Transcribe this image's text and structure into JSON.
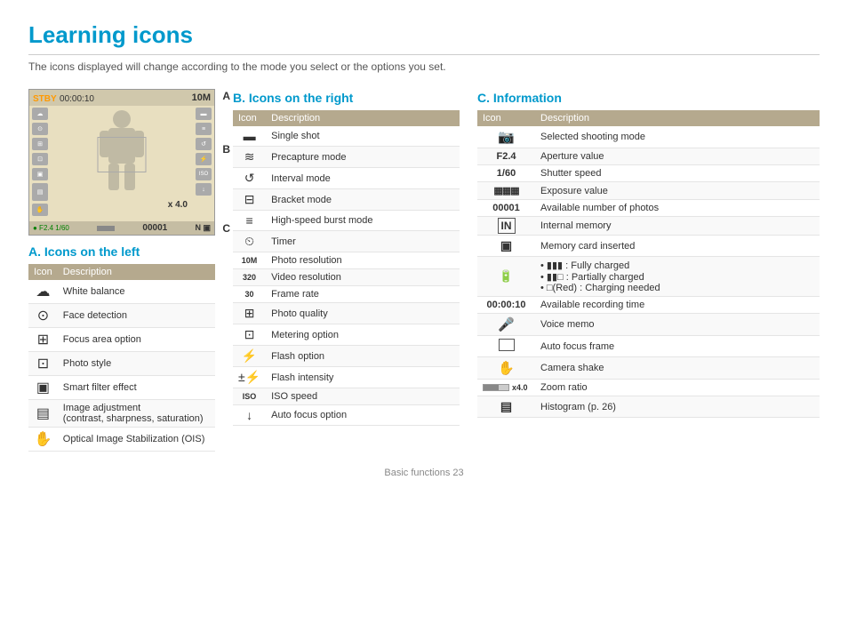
{
  "page": {
    "title": "Learning icons",
    "subtitle": "The icons displayed will change according to the mode you select or the options you set.",
    "footer": "Basic functions   23"
  },
  "viewfinder": {
    "stby": "STBY",
    "timer": "00:00:10",
    "top_right_icon": "10M",
    "zoom": "x 4.0",
    "frame_number": "00001",
    "label_a": "A",
    "label_b": "B",
    "label_c": "C"
  },
  "section_a": {
    "title": "A. Icons on the left",
    "col_icon": "Icon",
    "col_desc": "Description",
    "rows": [
      {
        "icon": "cloud",
        "desc": "White balance"
      },
      {
        "icon": "face",
        "desc": "Face detection"
      },
      {
        "icon": "focus",
        "desc": "Focus area option"
      },
      {
        "icon": "style",
        "desc": "Photo style"
      },
      {
        "icon": "filter",
        "desc": "Smart filter effect"
      },
      {
        "icon": "image-adj",
        "desc": "Image adjustment\n(contrast, sharpness, saturation)"
      },
      {
        "icon": "ois",
        "desc": "Optical Image Stabilization (OIS)"
      }
    ]
  },
  "section_b": {
    "title": "B. Icons on the right",
    "col_icon": "Icon",
    "col_desc": "Description",
    "rows": [
      {
        "icon": "single-shot",
        "desc": "Single shot"
      },
      {
        "icon": "precapture",
        "desc": "Precapture mode"
      },
      {
        "icon": "interval",
        "desc": "Interval mode"
      },
      {
        "icon": "bracket",
        "desc": "Bracket mode"
      },
      {
        "icon": "burst",
        "desc": "High-speed burst mode"
      },
      {
        "icon": "timer",
        "desc": "Timer"
      },
      {
        "icon": "resolution",
        "desc": "Photo resolution"
      },
      {
        "icon": "video-res",
        "desc": "Video resolution"
      },
      {
        "icon": "frame-rate",
        "desc": "Frame rate"
      },
      {
        "icon": "quality",
        "desc": "Photo quality"
      },
      {
        "icon": "metering",
        "desc": "Metering option"
      },
      {
        "icon": "flash",
        "desc": "Flash option"
      },
      {
        "icon": "flash-int",
        "desc": "Flash intensity"
      },
      {
        "icon": "iso",
        "desc": "ISO speed"
      },
      {
        "icon": "af",
        "desc": "Auto focus option"
      }
    ]
  },
  "section_c": {
    "title": "C. Information",
    "col_icon": "Icon",
    "col_desc": "Description",
    "rows": [
      {
        "icon": "shoot-mode",
        "icon_text": "📷",
        "desc": "Selected shooting mode"
      },
      {
        "icon": "aperture",
        "icon_text": "F2.4",
        "desc": "Aperture value"
      },
      {
        "icon": "shutter",
        "icon_text": "1/60",
        "desc": "Shutter speed"
      },
      {
        "icon": "exposure",
        "icon_text": "▦",
        "desc": "Exposure value"
      },
      {
        "icon": "photo-count",
        "icon_text": "00001",
        "desc": "Available number of photos"
      },
      {
        "icon": "int-memory",
        "icon_text": "IN",
        "desc": "Internal memory"
      },
      {
        "icon": "mem-card",
        "icon_text": "▣",
        "desc": "Memory card inserted"
      },
      {
        "icon": "battery",
        "icon_text": "🔋",
        "desc": "• ▮▮▮ : Fully charged\n• ▮▮□ : Partially charged\n• □(Red) : Charging needed"
      },
      {
        "icon": "rec-time",
        "icon_text": "00:00:10",
        "desc": "Available recording time"
      },
      {
        "icon": "voice-memo",
        "icon_text": "🎤",
        "desc": "Voice memo"
      },
      {
        "icon": "af-frame",
        "icon_text": "□",
        "desc": "Auto focus frame"
      },
      {
        "icon": "cam-shake",
        "icon_text": "✋",
        "desc": "Camera shake"
      },
      {
        "icon": "zoom-ratio",
        "icon_text": "x4.0",
        "desc": "Zoom ratio",
        "has_bar": true
      },
      {
        "icon": "histogram",
        "icon_text": "▤",
        "desc": "Histogram (p. 26)"
      }
    ]
  }
}
